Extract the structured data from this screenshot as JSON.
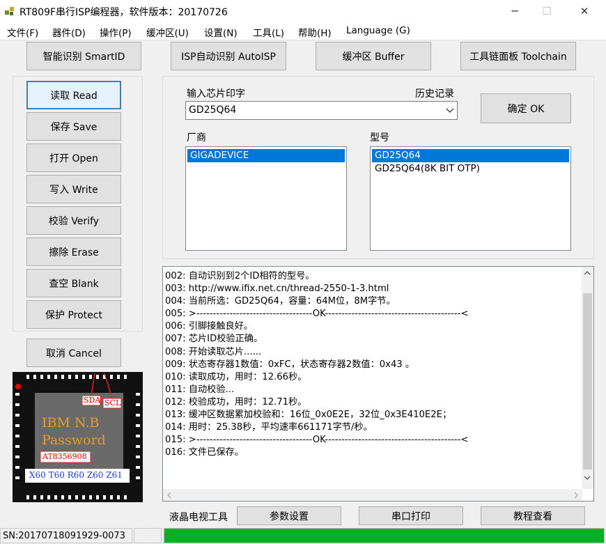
{
  "window": {
    "title": "RT809F串行ISP编程器，软件版本：20170726",
    "min_glyph": "─",
    "max_glyph": "☐",
    "close_glyph": "✕"
  },
  "menu": [
    "文件(F)",
    "器件(D)",
    "操作(P)",
    "缓冲区(U)",
    "设置(N)",
    "工具(L)",
    "帮助(H)",
    "Language (G)"
  ],
  "top_buttons": {
    "smartid": "智能识别 SmartID",
    "autoisp": "ISP自动识别 AutoISP",
    "buffer": "缓冲区 Buffer",
    "toolchain": "工具链面板 Toolchain"
  },
  "side_buttons": {
    "read": "读取 Read",
    "save": "保存 Save",
    "open": "打开 Open",
    "write": "写入 Write",
    "verify": "校验 Verify",
    "erase": "擦除 Erase",
    "blank": "查空 Blank",
    "protect": "保护 Protect",
    "cancel": "取消 Cancel"
  },
  "chip_panel": {
    "input_label": "输入芯片印字",
    "history_label": "历史记录",
    "chip_value": "GD25Q64",
    "ok_button": "确定 OK",
    "vendor_label": "厂商",
    "model_label": "型号",
    "vendors": [
      "GIGADEVICE"
    ],
    "models": [
      "GD25Q64",
      "GD25Q64(8K BIT OTP)"
    ]
  },
  "log_lines": [
    "002: 自动识别到2个ID相符的型号。",
    "003: http://www.ifix.net.cn/thread-2550-1-3.html",
    "004: 当前所选：GD25Q64，容量：64M位，8M字节。",
    "005: >-----------------------------------OK-----------------------------------------<",
    "006: 引脚接触良好。",
    "007: 芯片ID校验正确。",
    "008: 开始读取芯片......",
    "009: 状态寄存器1数值：0xFC，状态寄存器2数值：0x43 。",
    "010: 读取成功，用时：12.66秒。",
    "011: 自动校验...",
    "012: 校验成功，用时：12.71秒。",
    "013: 缓冲区数据累加校验和：16位_0x0E2E，32位_0x3E410E2E；",
    "014: 用时：25.38秒，平均速率661171字节/秒。",
    "015: >-----------------------------------OK-----------------------------------------<",
    "016: 文件已保存。"
  ],
  "chip_image": {
    "sda": "SDA",
    "scl": "SCL",
    "line1": "IBM N.B",
    "line2": "Password",
    "part": "AT8356908",
    "footer": "X60 T60 R60 Z60 Z61"
  },
  "bottom_bar": {
    "lcd_tools": "液晶电视工具",
    "params": "参数设置",
    "serial_print": "串口打印",
    "tutorial": "教程查看"
  },
  "status": {
    "sn": "SN:20170718091929-0073"
  },
  "colors": {
    "selection": "#0078d7",
    "progress": "#06b025",
    "focus_border": "#3c7fb1"
  }
}
